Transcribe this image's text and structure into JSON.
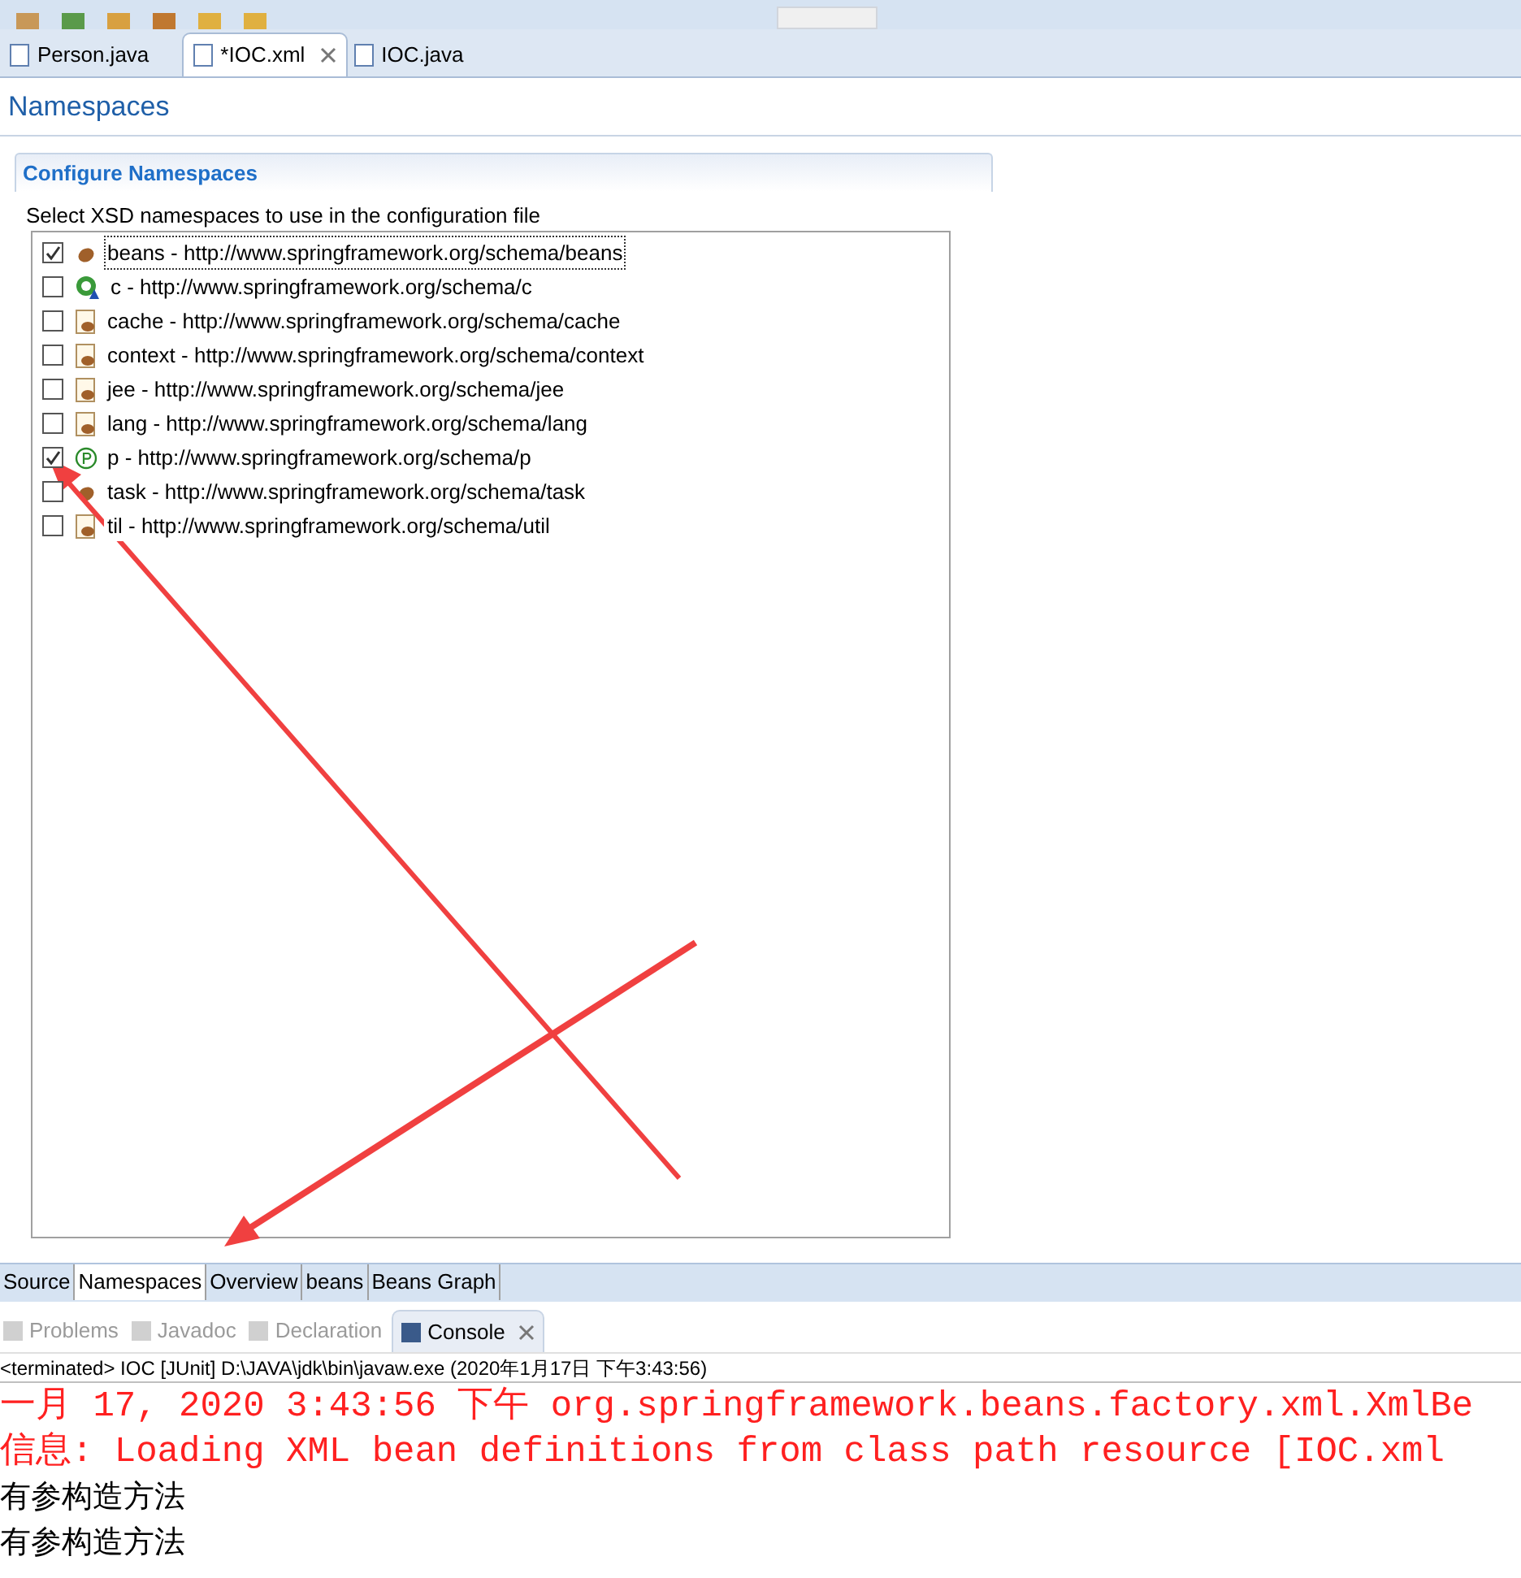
{
  "editor_tabs": [
    {
      "label": "Person.java",
      "selected": false
    },
    {
      "label": "*IOC.xml",
      "selected": true
    },
    {
      "label": "IOC.java",
      "selected": false
    }
  ],
  "page_title": "Namespaces",
  "section": {
    "title": "Configure Namespaces",
    "description": "Select XSD namespaces to use in the configuration file"
  },
  "namespaces": [
    {
      "label": "beans - http://www.springframework.org/schema/beans",
      "checked": true
    },
    {
      "label": "c - http://www.springframework.org/schema/c",
      "checked": false
    },
    {
      "label": "cache - http://www.springframework.org/schema/cache",
      "checked": false
    },
    {
      "label": "context - http://www.springframework.org/schema/context",
      "checked": false
    },
    {
      "label": "jee - http://www.springframework.org/schema/jee",
      "checked": false
    },
    {
      "label": "lang - http://www.springframework.org/schema/lang",
      "checked": false
    },
    {
      "label": "p - http://www.springframework.org/schema/p",
      "checked": true
    },
    {
      "label": "task - http://www.springframework.org/schema/task",
      "checked": false
    },
    {
      "label": "til - http://www.springframework.org/schema/util",
      "checked": false
    }
  ],
  "bottom_tabs": [
    {
      "label": "Source",
      "selected": false
    },
    {
      "label": "Namespaces",
      "selected": true
    },
    {
      "label": "Overview",
      "selected": false
    },
    {
      "label": "beans",
      "selected": false
    },
    {
      "label": "Beans Graph",
      "selected": false
    }
  ],
  "view_tabs": [
    {
      "label": "Problems",
      "selected": false
    },
    {
      "label": "Javadoc",
      "selected": false
    },
    {
      "label": "Declaration",
      "selected": false
    },
    {
      "label": "Console",
      "selected": true
    }
  ],
  "console": {
    "status": "<terminated> IOC [JUnit] D:\\JAVA\\jdk\\bin\\javaw.exe (2020年1月17日 下午3:43:56)",
    "lines": [
      {
        "text": "一月 17, 2020 3:43:56 下午 org.springframework.beans.factory.xml.XmlBe",
        "kind": "error"
      },
      {
        "text": "信息: Loading XML bean definitions from class path resource [IOC.xml",
        "kind": "error"
      },
      {
        "text": "有参构造方法",
        "kind": "out"
      },
      {
        "text": "有参构造方法",
        "kind": "out"
      }
    ]
  }
}
